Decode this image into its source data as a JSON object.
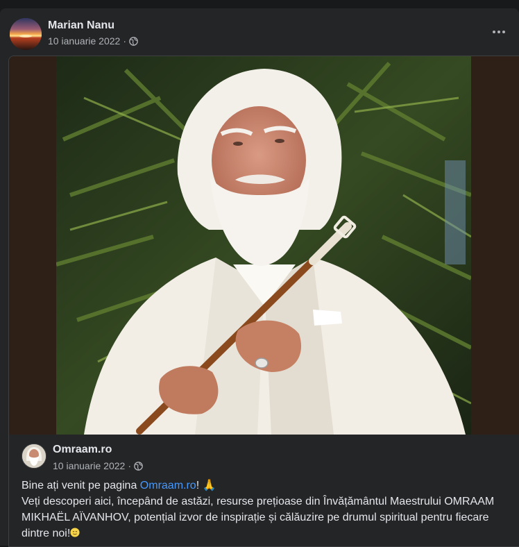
{
  "post": {
    "author": "Marian Nanu",
    "date": "10 ianuarie 2022",
    "separator": "·",
    "privacy_icon": "globe-icon",
    "more_icon": "more-options-icon"
  },
  "shared_post": {
    "author": "Omraam.ro",
    "date": "10 ianuarie 2022",
    "separator": "·",
    "privacy_icon": "globe-icon",
    "text": {
      "intro_before": "Bine ați venit pe pagina ",
      "intro_link": "Omraam.ro",
      "intro_after": "! ",
      "intro_emoji": "🙏",
      "body": "Veți descoperi aici, începând de astăzi, resurse prețioase din Învățământul Maestrului OMRAAM MIKHAËL AÏVANHOV, potențial izvor de inspirație și călăuzire pe drumul spiritual pentru fiecare dintre noi!",
      "end_emoji": "smiling-face-icon"
    }
  },
  "colors": {
    "background": "#18191a",
    "card": "#242526",
    "text": "#e4e6eb",
    "secondary_text": "#b0b3b8",
    "link": "#4599ff"
  }
}
